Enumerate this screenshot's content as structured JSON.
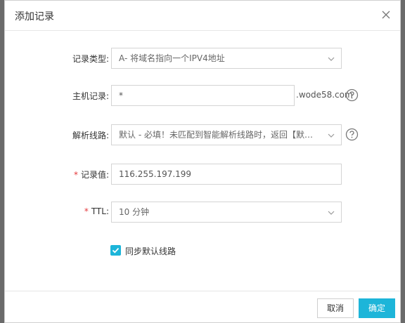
{
  "dialog": {
    "title": "添加记录",
    "close_icon": "close-icon"
  },
  "form": {
    "record_type": {
      "label": "记录类型:",
      "value": "A- 将域名指向一个IPV4地址"
    },
    "host": {
      "label": "主机记录:",
      "value": "*",
      "suffix": ".wode58.com"
    },
    "line": {
      "label": "解析线路:",
      "value": "默认 - 必填！未匹配到智能解析线路时，返回【默认】线路..."
    },
    "record_value": {
      "required_mark": "*",
      "label": "记录值:",
      "value": "116.255.197.199"
    },
    "ttl": {
      "required_mark": "*",
      "label": "TTL:",
      "value": "10 分钟"
    },
    "sync_default": {
      "checked": true,
      "label": "同步默认线路"
    }
  },
  "footer": {
    "cancel_label": "取消",
    "confirm_label": "确定"
  },
  "colors": {
    "accent": "#1db5d9",
    "required": "#e4393c"
  }
}
